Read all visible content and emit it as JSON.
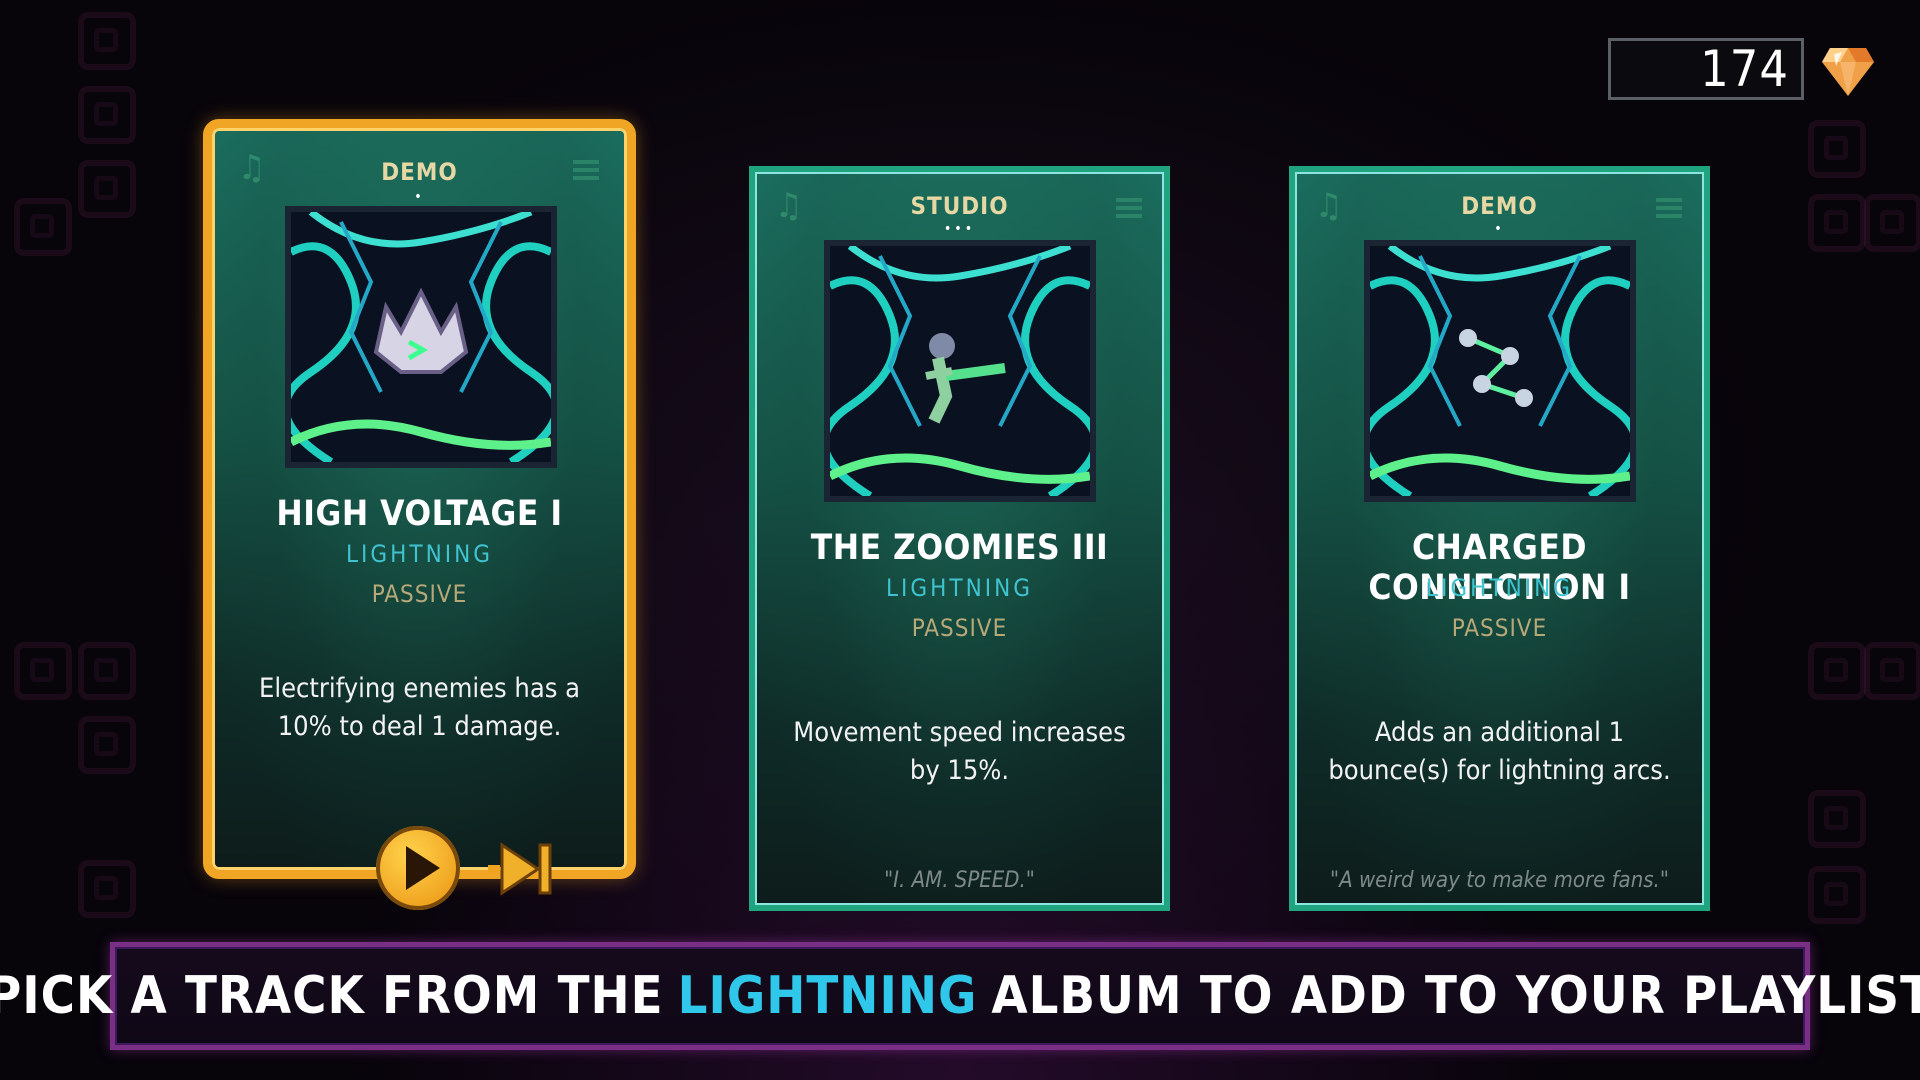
{
  "currency": {
    "amount": "174",
    "icon": "gem-icon"
  },
  "cards": [
    {
      "rarity": "DEMO",
      "rarity_dots": "•",
      "title": "HIGH VOLTAGE I",
      "element": "LIGHTNING",
      "type": "PASSIVE",
      "description": "Electrifying enemies has a 10% to deal 1 damage.",
      "quote": "",
      "selected": true,
      "art_icon": "spiky-crown-icon"
    },
    {
      "rarity": "STUDIO",
      "rarity_dots": "•••",
      "title": "THE ZOOMIES III",
      "element": "LIGHTNING",
      "type": "PASSIVE",
      "description": "Movement speed increases by 15%.",
      "quote": "\"I. AM. SPEED.\"",
      "selected": false,
      "art_icon": "running-figure-icon"
    },
    {
      "rarity": "DEMO",
      "rarity_dots": "•",
      "title": "CHARGED CONNECTION I",
      "element": "LIGHTNING",
      "type": "PASSIVE",
      "description": "Adds an additional 1 bounce(s) for lightning arcs.",
      "quote": "\"A weird way to make more fans.\"",
      "selected": false,
      "art_icon": "connected-nodes-icon"
    }
  ],
  "banner": {
    "prefix": "PICK A TRACK FROM THE",
    "highlight": "LIGHTNING",
    "suffix": "ALBUM TO ADD TO YOUR PLAYLIST"
  },
  "colors": {
    "selected_border": "#f1a524",
    "card_border": "#1fa47f",
    "element_text": "#3fc3d0",
    "highlight_text": "#2fc7ea"
  }
}
